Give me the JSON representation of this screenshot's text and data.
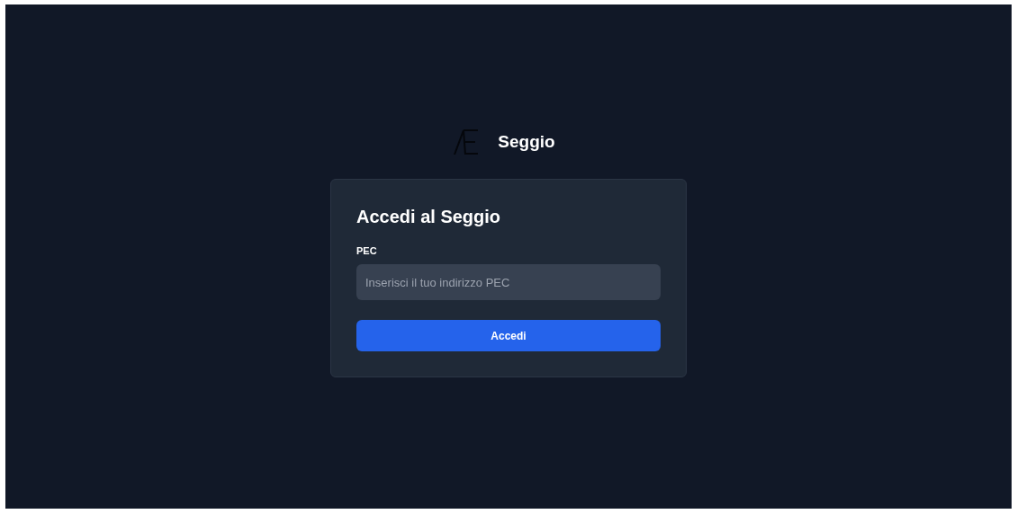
{
  "brand": {
    "name": "Seggio"
  },
  "card": {
    "title": "Accedi al Seggio",
    "field": {
      "label": "PEC",
      "placeholder": "Inserisci il tuo indirizzo PEC"
    },
    "button": "Accedi"
  }
}
